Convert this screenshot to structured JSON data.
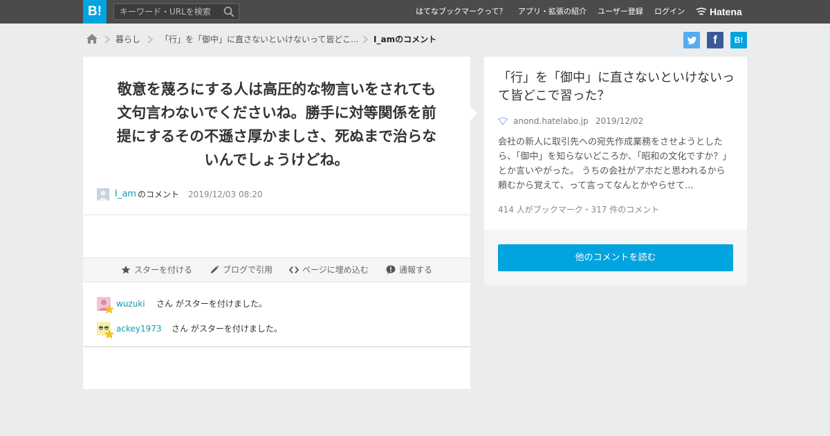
{
  "header": {
    "logo": "B!",
    "search_placeholder": "キーワード・URLを検索",
    "nav": [
      "はてなブックマークって？",
      "アプリ・拡張の紹介",
      "ユーザー登録",
      "ログイン"
    ],
    "hatena_label": "Hatena"
  },
  "breadcrumb": {
    "items": [
      "暮らし",
      "「行」を「御中」に直さないといけないって皆どこ...",
      "I_amのコメント"
    ]
  },
  "share": {
    "twitter_icon": "twitter-icon",
    "facebook_label": "f",
    "hatebu_label": "B!"
  },
  "comment": {
    "lines": [
      "敬意を蔑ろにする人は高圧的な物言いをされても",
      "文句言わないでくださいね。勝手に対等関係を前",
      "提にするその不遜さ厚かましさ、死ぬまで治らな",
      "いんでしょうけどね。"
    ],
    "user": "I_am",
    "user_suffix": "のコメント",
    "timestamp": "2019/12/03 08:20"
  },
  "actions": [
    "スターを付ける",
    "ブログで引用",
    "ページに埋め込む",
    "通報する"
  ],
  "stars": [
    {
      "user": "wuzuki",
      "text": "さん がスターを付けました。"
    },
    {
      "user": "ackey1973",
      "text": "さん がスターを付けました。"
    }
  ],
  "entry": {
    "title": "「行」を「御中」に直さないといけないって皆どこで習った？",
    "domain": "anond.hatelabo.jp",
    "date": "2019/12/02",
    "snippet": "会社の新人に取引先への宛先作成業務をさせようとしたら、「御中」を知らないどころか、「昭和の文化ですか？」とか言いやがった。 うちの会社がアホだと思われるから頼むから覚えて、って言ってなんとかやらせて...",
    "counts": "414 人がブックマーク・317 件のコメント",
    "read_button": "他のコメントを読む"
  },
  "colors": {
    "brand": "#00a4de",
    "link": "#0e9bb4",
    "header_bg": "#4b4b4b"
  }
}
